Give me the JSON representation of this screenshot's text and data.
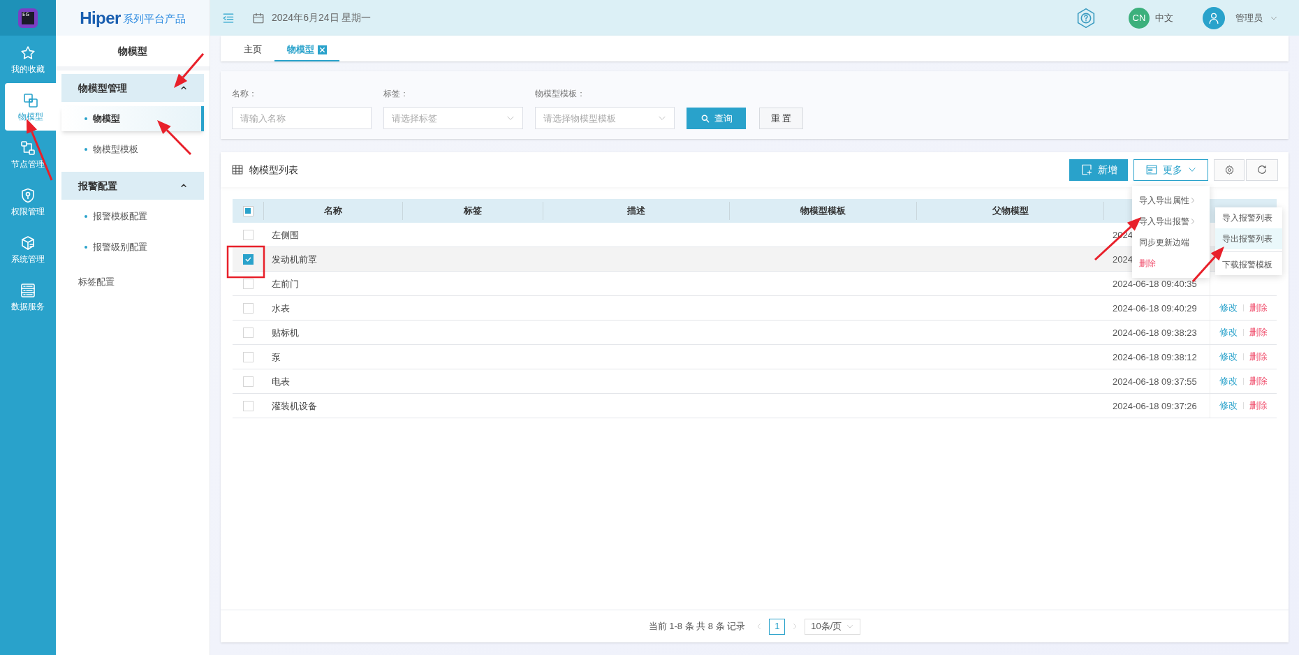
{
  "rail": {
    "logo": "EG",
    "items": [
      {
        "label": "我的收藏",
        "selected": false
      },
      {
        "label": "物模型",
        "selected": true
      },
      {
        "label": "节点管理",
        "selected": false
      },
      {
        "label": "权限管理",
        "selected": false
      },
      {
        "label": "系统管理",
        "selected": false
      },
      {
        "label": "数据服务",
        "selected": false
      }
    ]
  },
  "brand": {
    "name": "Hiper",
    "tagline": "系列平台产品"
  },
  "sidebar": {
    "title": "物模型",
    "items": [
      {
        "kind": "group",
        "label": "物模型管理",
        "expanded": true,
        "children": [
          {
            "label": "物模型",
            "selected": true
          },
          {
            "label": "物模型模板",
            "selected": false
          }
        ]
      },
      {
        "kind": "group",
        "label": "报警配置",
        "expanded": true,
        "children": [
          {
            "label": "报警模板配置",
            "selected": false
          },
          {
            "label": "报警级别配置",
            "selected": false
          }
        ]
      },
      {
        "kind": "link",
        "label": "标签配置"
      }
    ]
  },
  "header": {
    "date": "2024年6月24日 星期一",
    "language": {
      "badge": "CN",
      "label": "中文"
    },
    "user": "管理员"
  },
  "tabs": [
    {
      "label": "主页",
      "selected": false,
      "closable": false
    },
    {
      "label": "物模型",
      "selected": true,
      "closable": true
    }
  ],
  "filters": [
    {
      "kind": "input",
      "label": "名称：",
      "placeholder": "请输入名称"
    },
    {
      "kind": "select",
      "label": "标签：",
      "placeholder": "请选择标签"
    },
    {
      "kind": "select",
      "label": "物模型模板：",
      "placeholder": "请选择物模型模板"
    }
  ],
  "filter_buttons": {
    "search": "查询",
    "reset": "重 置"
  },
  "list": {
    "title": "物模型列表",
    "add": "新增",
    "more": "更多",
    "all_indeterminate": true,
    "columns": [
      "名称",
      "标签",
      "描述",
      "物模型模板",
      "父物模型"
    ],
    "rows": [
      {
        "checked": false,
        "name": "左侧围",
        "time": "2024",
        "actions": []
      },
      {
        "checked": true,
        "name": "发动机前罩",
        "time": "2024",
        "actions": []
      },
      {
        "checked": false,
        "name": "左前门",
        "time": "2024-06-18 09:40:35",
        "actions": []
      },
      {
        "checked": false,
        "name": "水表",
        "time": "2024-06-18 09:40:29",
        "actions": [
          {
            "kind": "edit",
            "label": "修改"
          },
          {
            "kind": "delete",
            "label": "删除"
          }
        ]
      },
      {
        "checked": false,
        "name": "贴标机",
        "time": "2024-06-18 09:38:23",
        "actions": [
          {
            "kind": "edit",
            "label": "修改"
          },
          {
            "kind": "delete",
            "label": "删除"
          }
        ]
      },
      {
        "checked": false,
        "name": "泵",
        "time": "2024-06-18 09:38:12",
        "actions": [
          {
            "kind": "edit",
            "label": "修改"
          },
          {
            "kind": "delete",
            "label": "删除"
          }
        ]
      },
      {
        "checked": false,
        "name": "电表",
        "time": "2024-06-18 09:37:55",
        "actions": [
          {
            "kind": "edit",
            "label": "修改"
          },
          {
            "kind": "delete",
            "label": "删除"
          }
        ]
      },
      {
        "checked": false,
        "name": "灌装机设备",
        "time": "2024-06-18 09:37:26",
        "actions": [
          {
            "kind": "edit",
            "label": "修改"
          },
          {
            "kind": "delete",
            "label": "删除"
          }
        ]
      }
    ],
    "menu": [
      {
        "kind": "submenu",
        "label": "导入导出属性"
      },
      {
        "kind": "submenu",
        "label": "导入导出报警"
      },
      {
        "kind": "normal",
        "label": "同步更新边端"
      },
      {
        "kind": "danger",
        "label": "删除"
      }
    ],
    "submenu": [
      {
        "label": "导入报警列表",
        "selected": false,
        "divider_before": false
      },
      {
        "label": "导出报警列表",
        "selected": true,
        "divider_before": false
      },
      {
        "label": "下载报警模板",
        "selected": false,
        "divider_before": true
      }
    ]
  },
  "pagination": {
    "summary": "当前 1-8 条 共 8 条 记录",
    "page": "1",
    "page_size": "10条/页"
  }
}
